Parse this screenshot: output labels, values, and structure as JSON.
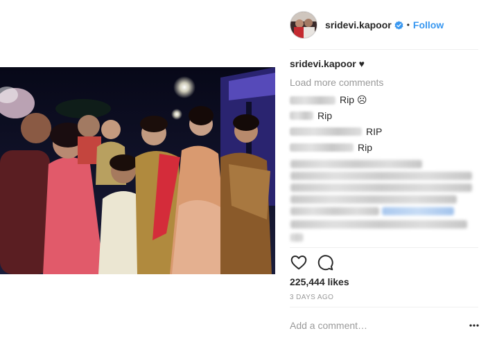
{
  "post": {
    "username": "sridevi.kapoor",
    "separator": "•",
    "follow_label": "Follow",
    "verified_icon": "verified-badge-icon",
    "caption_user": "sridevi.kapoor",
    "caption_text": "♥",
    "load_more": "Load more comments",
    "comments": [
      {
        "text": "Rip ☹"
      },
      {
        "text": "Rip"
      },
      {
        "text": "RIP"
      },
      {
        "text": "Rip"
      }
    ],
    "likes": "225,444 likes",
    "timestamp": "3 DAYS AGO",
    "add_comment_placeholder": "Add a comment…"
  },
  "icons": {
    "like": "heart-icon",
    "comment": "comment-icon",
    "more": "more-options-icon"
  },
  "colors": {
    "link": "#3897f0",
    "secondary_text": "#999999",
    "primary_text": "#262626",
    "divider": "#efefef"
  }
}
